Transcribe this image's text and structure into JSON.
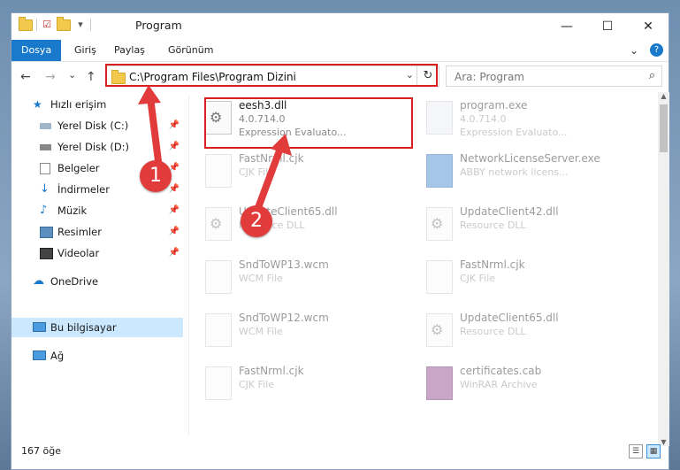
{
  "window": {
    "title": "Program",
    "controls": {
      "minimize": "—",
      "maximize": "☐",
      "close": "✕"
    }
  },
  "ribbon": {
    "tabs": [
      {
        "label": "Dosya",
        "active": true
      },
      {
        "label": "Giriş"
      },
      {
        "label": "Paylaş"
      },
      {
        "label": "Görünüm"
      }
    ]
  },
  "nav": {
    "back": "←",
    "forward": "→",
    "recent": "⌄",
    "up": "↑",
    "address": "C:\\Program Files\\Program Dizini",
    "search_placeholder": "Ara: Program"
  },
  "sidebar": {
    "items": [
      {
        "label": "Hızlı erişim",
        "icon": "star-icon"
      },
      {
        "label": "Yerel Disk (C:)",
        "icon": "drive-icon",
        "pinned": true
      },
      {
        "label": "Yerel Disk (D:)",
        "icon": "drive-icon",
        "pinned": true
      },
      {
        "label": "Belgeler",
        "icon": "documents-icon",
        "pinned": true
      },
      {
        "label": "İndirmeler",
        "icon": "download-icon",
        "pinned": true
      },
      {
        "label": "Müzik",
        "icon": "music-icon",
        "pinned": true
      },
      {
        "label": "Resimler",
        "icon": "pictures-icon",
        "pinned": true
      },
      {
        "label": "Videolar",
        "icon": "videos-icon",
        "pinned": true
      },
      {
        "label": "OneDrive",
        "icon": "cloud-icon"
      },
      {
        "label": "Bu bilgisayar",
        "icon": "computer-icon",
        "selected": true
      },
      {
        "label": "Ağ",
        "icon": "network-icon"
      }
    ]
  },
  "files": [
    {
      "name": "eesh3.dll",
      "line2": "4.0.714.0",
      "line3": "Expression Evaluato...",
      "highlighted": true
    },
    {
      "name": "program.exe",
      "line2": "4.0.714.0",
      "line3": "Expression Evaluato..."
    },
    {
      "name": "FastNrml.cjk",
      "line2": "CJK File"
    },
    {
      "name": "NetworkLicenseServer.exe",
      "line2": "ABBY network licens..."
    },
    {
      "name": "UpdateClient65.dll",
      "line2": "Resource DLL"
    },
    {
      "name": "UpdateClient42.dll",
      "line2": "Resource DLL"
    },
    {
      "name": "SndToWP13.wcm",
      "line2": "WCM File"
    },
    {
      "name": "FastNrml.cjk",
      "line2": "CJK File"
    },
    {
      "name": "SndToWP12.wcm",
      "line2": "WCM File"
    },
    {
      "name": "UpdateClient65.dll",
      "line2": "Resource DLL"
    },
    {
      "name": "FastNrml.cjk",
      "line2": "CJK File"
    },
    {
      "name": "certificates.cab",
      "line2": "WinRAR Archive"
    }
  ],
  "status": {
    "count": "167 öğe"
  },
  "markers": [
    "1",
    "2"
  ],
  "colors": {
    "accent": "#1979ca",
    "highlight": "#d81e1e"
  }
}
